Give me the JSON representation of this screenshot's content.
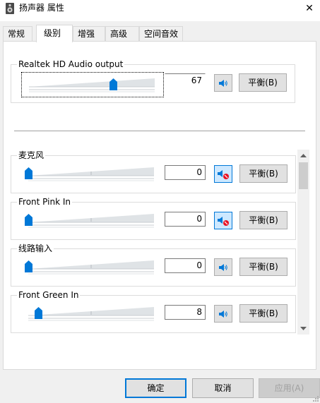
{
  "window": {
    "title": "扬声器 属性",
    "close_glyph": "✕"
  },
  "tabs": [
    {
      "label": "常规"
    },
    {
      "label": "级别",
      "active": true
    },
    {
      "label": "增强"
    },
    {
      "label": "高级"
    },
    {
      "label": "空间音效"
    }
  ],
  "master": {
    "label": "Realtek HD Audio output",
    "value": "67",
    "level": 0.67,
    "muted": false,
    "balance": "平衡(B)"
  },
  "channels": [
    {
      "label": "麦克风",
      "value": "0",
      "level": 0.0,
      "muted": true,
      "balance": "平衡(B)"
    },
    {
      "label": "Front Pink In",
      "value": "0",
      "level": 0.0,
      "muted": true,
      "balance": "平衡(B)"
    },
    {
      "label": "线路输入",
      "value": "0",
      "level": 0.0,
      "muted": false,
      "balance": "平衡(B)"
    },
    {
      "label": "Front Green In",
      "value": "8",
      "level": 0.08,
      "muted": false,
      "balance": "平衡(B)"
    }
  ],
  "footer": {
    "ok": "确定",
    "cancel": "取消",
    "apply": "应用(A)"
  },
  "icons": {
    "speaker": "speaker-icon",
    "mute": "speaker-muted-icon",
    "app": "speaker-app-icon"
  },
  "colors": {
    "accent": "#0078d7",
    "mute_badge": "#e81123"
  }
}
